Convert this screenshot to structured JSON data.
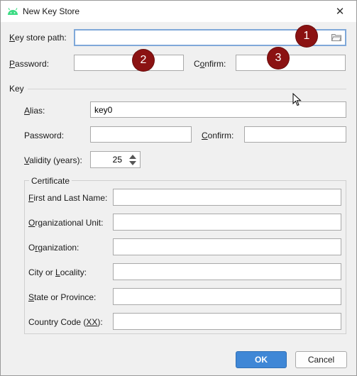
{
  "window": {
    "title": "New Key Store",
    "close_glyph": "✕"
  },
  "keystore": {
    "path_label_u": "K",
    "path_label_rest": "ey store path:",
    "path_value": "",
    "password_label_u": "P",
    "password_label_rest": "assword:",
    "confirm_label_pre": "C",
    "confirm_label_u": "o",
    "confirm_label_rest": "nfirm:"
  },
  "key": {
    "section_label": "Key",
    "alias_label_u": "A",
    "alias_label_rest": "lias:",
    "alias_value": "key0",
    "password_label": "Password:",
    "confirm_label_u": "C",
    "confirm_label_rest": "onfirm:",
    "validity_label_u": "V",
    "validity_label_rest": "alidity (years):",
    "validity_value": "25"
  },
  "certificate": {
    "title": "Certificate",
    "fields": [
      {
        "label_u": "F",
        "label_rest": "irst and Last Name:"
      },
      {
        "label_u": "O",
        "label_rest": "rganizational Unit:"
      },
      {
        "label_pre": "O",
        "label_u": "r",
        "label_rest": "ganization:"
      },
      {
        "label_pre": "City or ",
        "label_u": "L",
        "label_rest": "ocality:"
      },
      {
        "label_u": "S",
        "label_rest": "tate or Province:"
      },
      {
        "label_pre": "Country Code (",
        "label_u": "XX",
        "label_rest": "):"
      }
    ]
  },
  "badges": [
    "1",
    "2",
    "3"
  ],
  "buttons": {
    "ok": "OK",
    "cancel": "Cancel"
  },
  "colors": {
    "accent": "#3f87d6",
    "badge": "#8b1212"
  },
  "icons": [
    "android-icon",
    "close-icon",
    "folder-icon",
    "spinner-up-icon",
    "spinner-down-icon",
    "mouse-cursor-icon"
  ]
}
